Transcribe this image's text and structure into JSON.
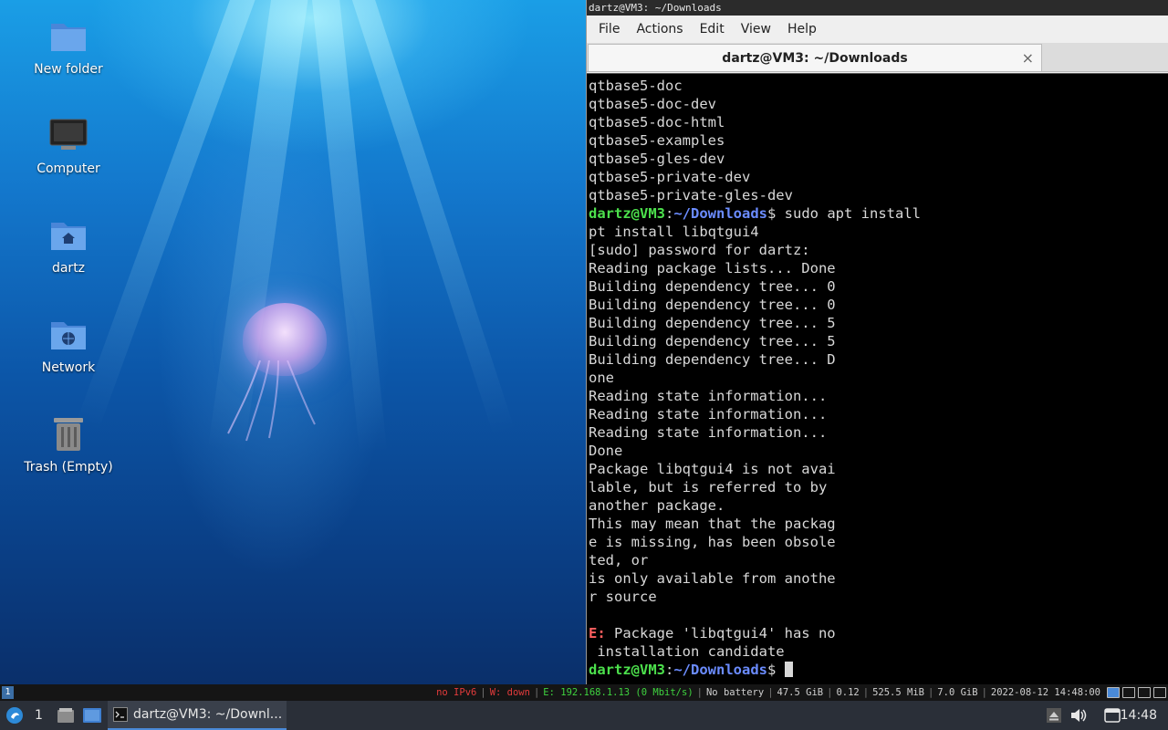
{
  "desktop": {
    "icons": [
      {
        "label": "New folder",
        "icon": "folder-icon"
      },
      {
        "label": "Computer",
        "icon": "computer-icon"
      },
      {
        "label": "dartz",
        "icon": "home-folder-icon"
      },
      {
        "label": "Network",
        "icon": "network-folder-icon"
      },
      {
        "label": "Trash (Empty)",
        "icon": "trash-icon"
      }
    ]
  },
  "window": {
    "title": "dartz@VM3: ~/Downloads",
    "menu": [
      "File",
      "Actions",
      "Edit",
      "View",
      "Help"
    ],
    "tab_label": "dartz@VM3: ~/Downloads",
    "tab_close": "×"
  },
  "terminal": {
    "prompt_user": "dartz@VM3",
    "prompt_sep": ":",
    "prompt_path": "~/Downloads",
    "prompt_dollar": "$ ",
    "lines_before": [
      "qtbase5-doc",
      "qtbase5-doc-dev",
      "qtbase5-doc-html",
      "qtbase5-examples",
      "qtbase5-gles-dev",
      "qtbase5-private-dev",
      "qtbase5-private-gles-dev"
    ],
    "command": "sudo apt install",
    "output": [
      "pt install libqtgui4",
      "[sudo] password for dartz:",
      "Reading package lists... Done",
      "Building dependency tree... 0",
      "Building dependency tree... 0",
      "Building dependency tree... 5",
      "Building dependency tree... 5",
      "Building dependency tree... D",
      "one",
      "Reading state information...",
      "Reading state information...",
      "Reading state information...",
      "Done",
      "Package libqtgui4 is not avai",
      "lable, but is referred to by",
      "another package.",
      "This may mean that the packag",
      "e is missing, has been obsole",
      "ted, or",
      "is only available from anothe",
      "r source",
      ""
    ],
    "error_prefix": "E:",
    "error_line1": " Package 'libqtgui4' has no",
    "error_line2": " installation candidate"
  },
  "statusbar": {
    "workspace": "1",
    "ipv6": "no IPv6",
    "wifi": "W: down",
    "ethernet": "E: 192.168.1.13 (0 Mbit/s)",
    "battery": "No battery",
    "disk": "47.5 GiB",
    "load": "0.12",
    "memory": "525.5 MiB",
    "memory_total": "7.0 GiB",
    "datetime": "2022-08-12 14:48:00"
  },
  "taskbar": {
    "workspace": "1",
    "task_title": "dartz@VM3: ~/Downl...",
    "clock": "14:48"
  },
  "colors": {
    "prompt_user": "#4ce04c",
    "prompt_path": "#6b8cff",
    "error": "#ff5f5f"
  }
}
